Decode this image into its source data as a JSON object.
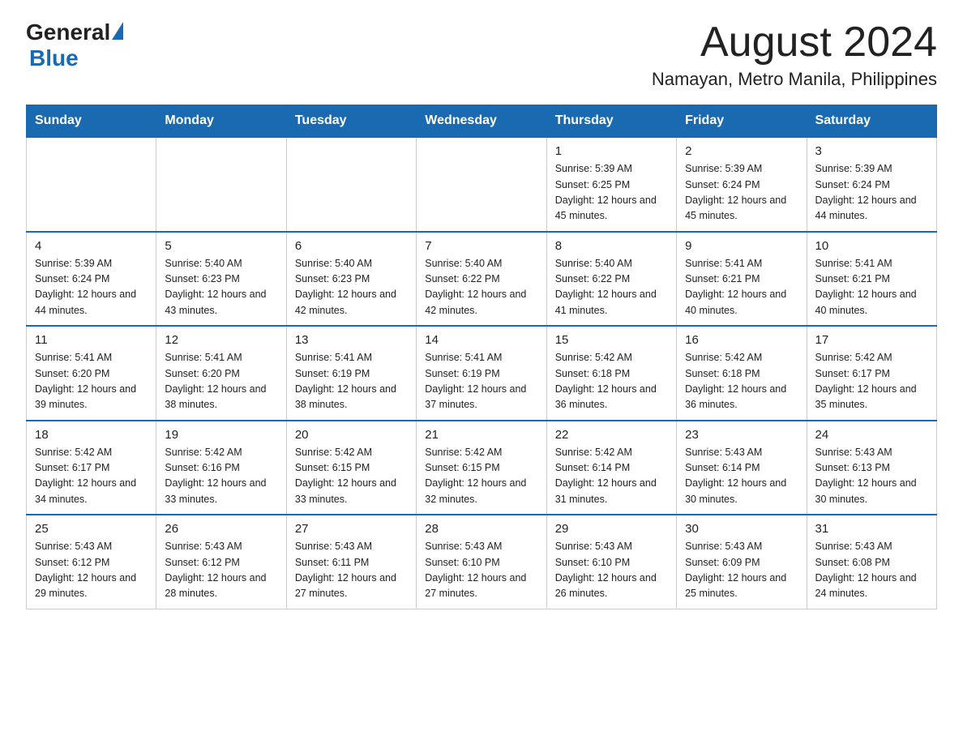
{
  "header": {
    "logo_general": "General",
    "logo_blue": "Blue",
    "month_title": "August 2024",
    "location": "Namayan, Metro Manila, Philippines"
  },
  "calendar": {
    "days_of_week": [
      "Sunday",
      "Monday",
      "Tuesday",
      "Wednesday",
      "Thursday",
      "Friday",
      "Saturday"
    ],
    "weeks": [
      [
        {
          "day": "",
          "info": ""
        },
        {
          "day": "",
          "info": ""
        },
        {
          "day": "",
          "info": ""
        },
        {
          "day": "",
          "info": ""
        },
        {
          "day": "1",
          "info": "Sunrise: 5:39 AM\nSunset: 6:25 PM\nDaylight: 12 hours and 45 minutes."
        },
        {
          "day": "2",
          "info": "Sunrise: 5:39 AM\nSunset: 6:24 PM\nDaylight: 12 hours and 45 minutes."
        },
        {
          "day": "3",
          "info": "Sunrise: 5:39 AM\nSunset: 6:24 PM\nDaylight: 12 hours and 44 minutes."
        }
      ],
      [
        {
          "day": "4",
          "info": "Sunrise: 5:39 AM\nSunset: 6:24 PM\nDaylight: 12 hours and 44 minutes."
        },
        {
          "day": "5",
          "info": "Sunrise: 5:40 AM\nSunset: 6:23 PM\nDaylight: 12 hours and 43 minutes."
        },
        {
          "day": "6",
          "info": "Sunrise: 5:40 AM\nSunset: 6:23 PM\nDaylight: 12 hours and 42 minutes."
        },
        {
          "day": "7",
          "info": "Sunrise: 5:40 AM\nSunset: 6:22 PM\nDaylight: 12 hours and 42 minutes."
        },
        {
          "day": "8",
          "info": "Sunrise: 5:40 AM\nSunset: 6:22 PM\nDaylight: 12 hours and 41 minutes."
        },
        {
          "day": "9",
          "info": "Sunrise: 5:41 AM\nSunset: 6:21 PM\nDaylight: 12 hours and 40 minutes."
        },
        {
          "day": "10",
          "info": "Sunrise: 5:41 AM\nSunset: 6:21 PM\nDaylight: 12 hours and 40 minutes."
        }
      ],
      [
        {
          "day": "11",
          "info": "Sunrise: 5:41 AM\nSunset: 6:20 PM\nDaylight: 12 hours and 39 minutes."
        },
        {
          "day": "12",
          "info": "Sunrise: 5:41 AM\nSunset: 6:20 PM\nDaylight: 12 hours and 38 minutes."
        },
        {
          "day": "13",
          "info": "Sunrise: 5:41 AM\nSunset: 6:19 PM\nDaylight: 12 hours and 38 minutes."
        },
        {
          "day": "14",
          "info": "Sunrise: 5:41 AM\nSunset: 6:19 PM\nDaylight: 12 hours and 37 minutes."
        },
        {
          "day": "15",
          "info": "Sunrise: 5:42 AM\nSunset: 6:18 PM\nDaylight: 12 hours and 36 minutes."
        },
        {
          "day": "16",
          "info": "Sunrise: 5:42 AM\nSunset: 6:18 PM\nDaylight: 12 hours and 36 minutes."
        },
        {
          "day": "17",
          "info": "Sunrise: 5:42 AM\nSunset: 6:17 PM\nDaylight: 12 hours and 35 minutes."
        }
      ],
      [
        {
          "day": "18",
          "info": "Sunrise: 5:42 AM\nSunset: 6:17 PM\nDaylight: 12 hours and 34 minutes."
        },
        {
          "day": "19",
          "info": "Sunrise: 5:42 AM\nSunset: 6:16 PM\nDaylight: 12 hours and 33 minutes."
        },
        {
          "day": "20",
          "info": "Sunrise: 5:42 AM\nSunset: 6:15 PM\nDaylight: 12 hours and 33 minutes."
        },
        {
          "day": "21",
          "info": "Sunrise: 5:42 AM\nSunset: 6:15 PM\nDaylight: 12 hours and 32 minutes."
        },
        {
          "day": "22",
          "info": "Sunrise: 5:42 AM\nSunset: 6:14 PM\nDaylight: 12 hours and 31 minutes."
        },
        {
          "day": "23",
          "info": "Sunrise: 5:43 AM\nSunset: 6:14 PM\nDaylight: 12 hours and 30 minutes."
        },
        {
          "day": "24",
          "info": "Sunrise: 5:43 AM\nSunset: 6:13 PM\nDaylight: 12 hours and 30 minutes."
        }
      ],
      [
        {
          "day": "25",
          "info": "Sunrise: 5:43 AM\nSunset: 6:12 PM\nDaylight: 12 hours and 29 minutes."
        },
        {
          "day": "26",
          "info": "Sunrise: 5:43 AM\nSunset: 6:12 PM\nDaylight: 12 hours and 28 minutes."
        },
        {
          "day": "27",
          "info": "Sunrise: 5:43 AM\nSunset: 6:11 PM\nDaylight: 12 hours and 27 minutes."
        },
        {
          "day": "28",
          "info": "Sunrise: 5:43 AM\nSunset: 6:10 PM\nDaylight: 12 hours and 27 minutes."
        },
        {
          "day": "29",
          "info": "Sunrise: 5:43 AM\nSunset: 6:10 PM\nDaylight: 12 hours and 26 minutes."
        },
        {
          "day": "30",
          "info": "Sunrise: 5:43 AM\nSunset: 6:09 PM\nDaylight: 12 hours and 25 minutes."
        },
        {
          "day": "31",
          "info": "Sunrise: 5:43 AM\nSunset: 6:08 PM\nDaylight: 12 hours and 24 minutes."
        }
      ]
    ]
  }
}
